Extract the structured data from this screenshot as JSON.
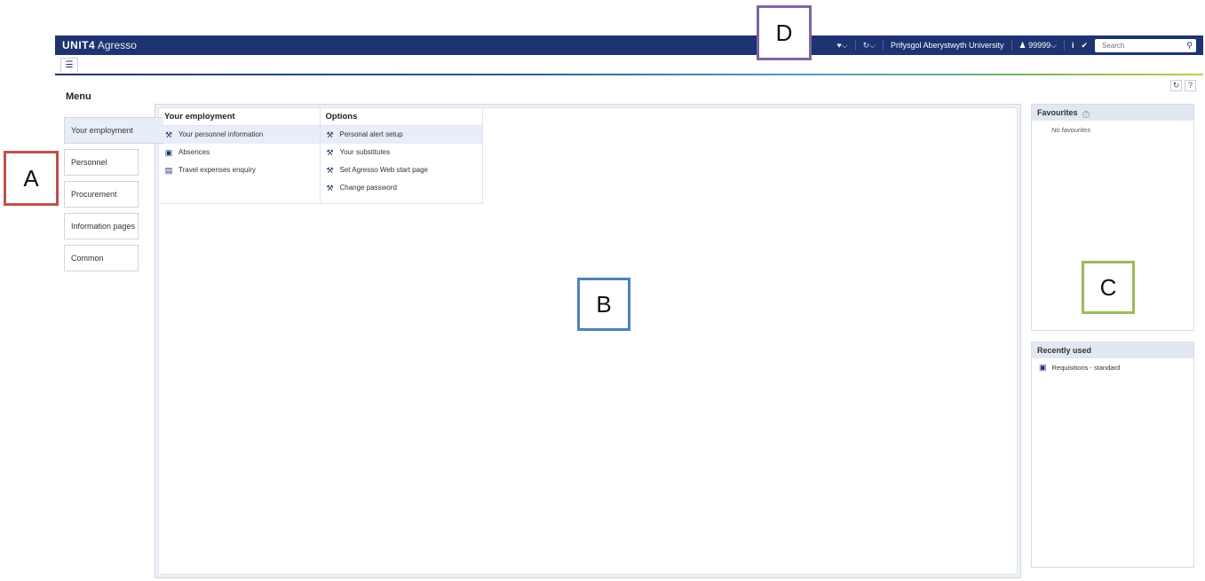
{
  "app": {
    "brand_bold": "UNIT4",
    "brand_name": "Agresso"
  },
  "topbar": {
    "heart_icon": "♥⌵",
    "history_icon": "↻⌵",
    "organisation": "Prifysgol Aberystwyth University",
    "user": "♟ 99999⌵",
    "info_icon": "i",
    "check_icon": "✔",
    "search_placeholder": "Search",
    "search_icon": "⚲"
  },
  "tabs": {
    "menu_tab_icon": "☰"
  },
  "page": {
    "title": "Menu",
    "refresh_icon": "↻",
    "help_icon": "?"
  },
  "nav": {
    "items": [
      {
        "label": "Your employment"
      },
      {
        "label": "Personnel"
      },
      {
        "label": "Procurement"
      },
      {
        "label": "Information pages"
      },
      {
        "label": "Common"
      }
    ]
  },
  "menu": {
    "col1": {
      "heading": "Your employment",
      "items": [
        {
          "label": "Your personnel information",
          "icon": "⚒"
        },
        {
          "label": "Absences",
          "icon": "▣"
        },
        {
          "label": "Travel expenses enquiry",
          "icon": "▤"
        }
      ]
    },
    "col2": {
      "heading": "Options",
      "items": [
        {
          "label": "Personal alert setup",
          "icon": "⚒"
        },
        {
          "label": "Your substitutes",
          "icon": "⚒"
        },
        {
          "label": "Set Agresso Web start page",
          "icon": "⚒"
        },
        {
          "label": "Change password",
          "icon": "⚒"
        }
      ]
    }
  },
  "favourites": {
    "heading": "Favourites",
    "help": "?",
    "empty_text": "No favourites"
  },
  "recent": {
    "heading": "Recently used",
    "items": [
      {
        "label": "Requisitions - standard",
        "icon": "▣"
      }
    ]
  },
  "annotations": {
    "a": "A",
    "b": "B",
    "c": "C",
    "d": "D"
  },
  "colors": {
    "topbar": "#1d3372",
    "label_a": "#c0504d",
    "label_b": "#4f81bd",
    "label_c": "#9bbb59",
    "label_d": "#8064a2"
  }
}
